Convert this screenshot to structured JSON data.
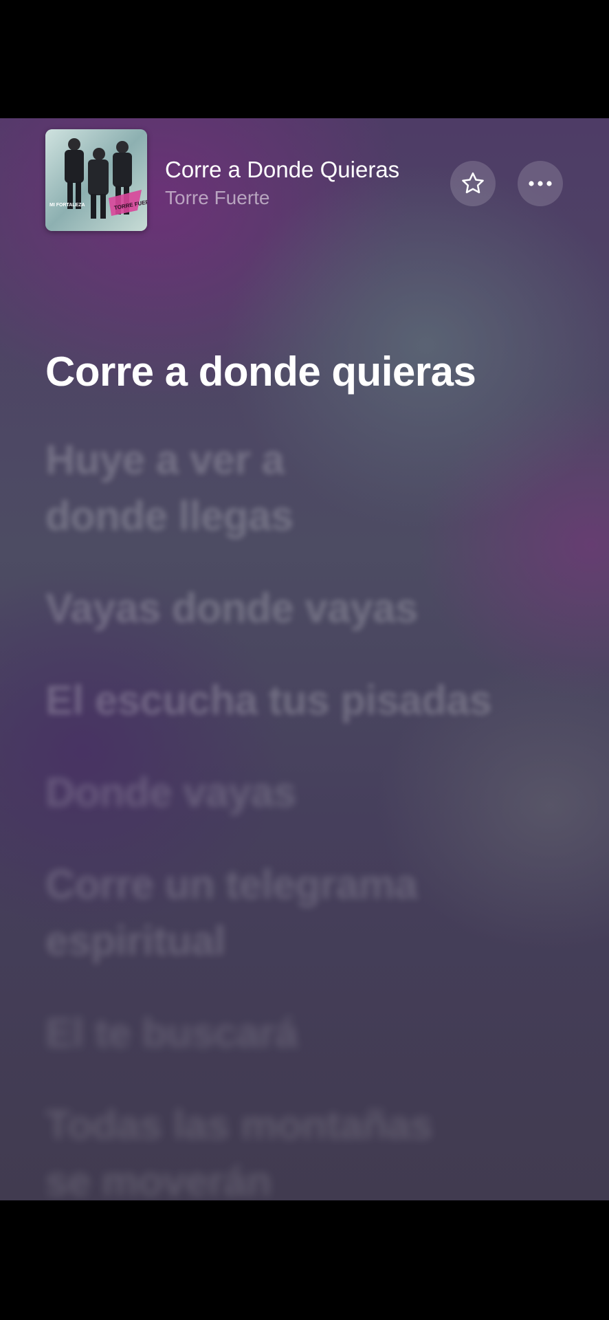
{
  "now_playing": {
    "title": "Corre a Donde Quieras",
    "artist": "Torre Fuerte",
    "album_art_text": [
      "MI FORTALEZA",
      "TORRE FUERTE"
    ]
  },
  "actions": {
    "favorite_icon": "star-icon",
    "more_icon": "ellipsis-icon"
  },
  "lyrics": [
    {
      "text": "Corre a donde quieras",
      "active": true
    },
    {
      "text": "Huye a ver a\ndonde llegas",
      "active": false
    },
    {
      "text": "Vayas donde vayas",
      "active": false
    },
    {
      "text": "El escucha tus pisadas",
      "active": false
    },
    {
      "text": "Donde vayas",
      "active": false
    },
    {
      "text": "Corre un telegrama\nespiritual",
      "active": false
    },
    {
      "text": "El te buscará",
      "active": false
    },
    {
      "text": "Todas las montañas\nse moverán",
      "active": false
    }
  ],
  "colors": {
    "active_lyric": "#ffffff",
    "inactive_lyric": "rgba(255,255,255,0.22)"
  }
}
